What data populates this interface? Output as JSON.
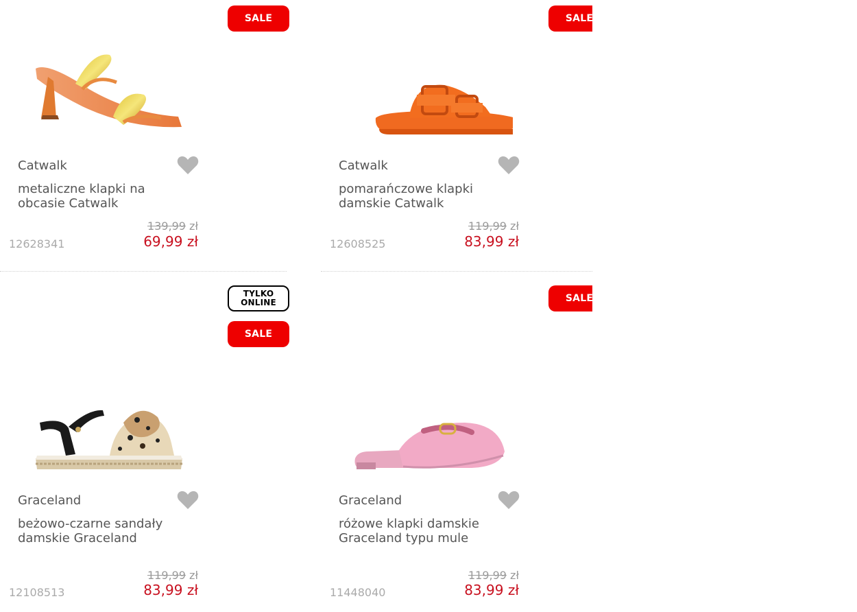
{
  "products": [
    {
      "badges": [
        "SALE"
      ],
      "brand": "Catwalk",
      "name": "metaliczne klapki na obcasie Catwalk",
      "old_price": "139,99",
      "currency": "zł",
      "new_price": "69,99 zł",
      "sku": "12628341",
      "image_icon": "metallic-heel-sandal-image"
    },
    {
      "badges": [
        "SALE"
      ],
      "brand": "Catwalk",
      "name": "pomarańczowe klapki damskie Catwalk",
      "old_price": "119,99",
      "currency": "zł",
      "new_price": "83,99 zł",
      "sku": "12608525",
      "image_icon": "orange-slide-image"
    },
    {
      "badges": [
        "TYLKO ONLINE",
        "SALE"
      ],
      "brand": "Graceland",
      "name": "beżowo-czarne sandały damskie Graceland",
      "old_price": "119,99",
      "currency": "zł",
      "new_price": "83,99 zł",
      "sku": "12108513",
      "image_icon": "espadrille-sandal-image"
    },
    {
      "badges": [
        "SALE"
      ],
      "brand": "Graceland",
      "name": "różowe klapki damskie Graceland typu mule",
      "old_price": "119,99",
      "currency": "zł",
      "new_price": "83,99 zł",
      "sku": "11448040",
      "image_icon": "pink-mule-image"
    }
  ],
  "badge_labels": {
    "sale": "SALE",
    "online_line1": "TYLKO",
    "online_line2": "ONLINE"
  },
  "colors": {
    "sale_red": "#ee0000",
    "price_red": "#c8101f",
    "heart_grey": "#b5b5b5"
  }
}
